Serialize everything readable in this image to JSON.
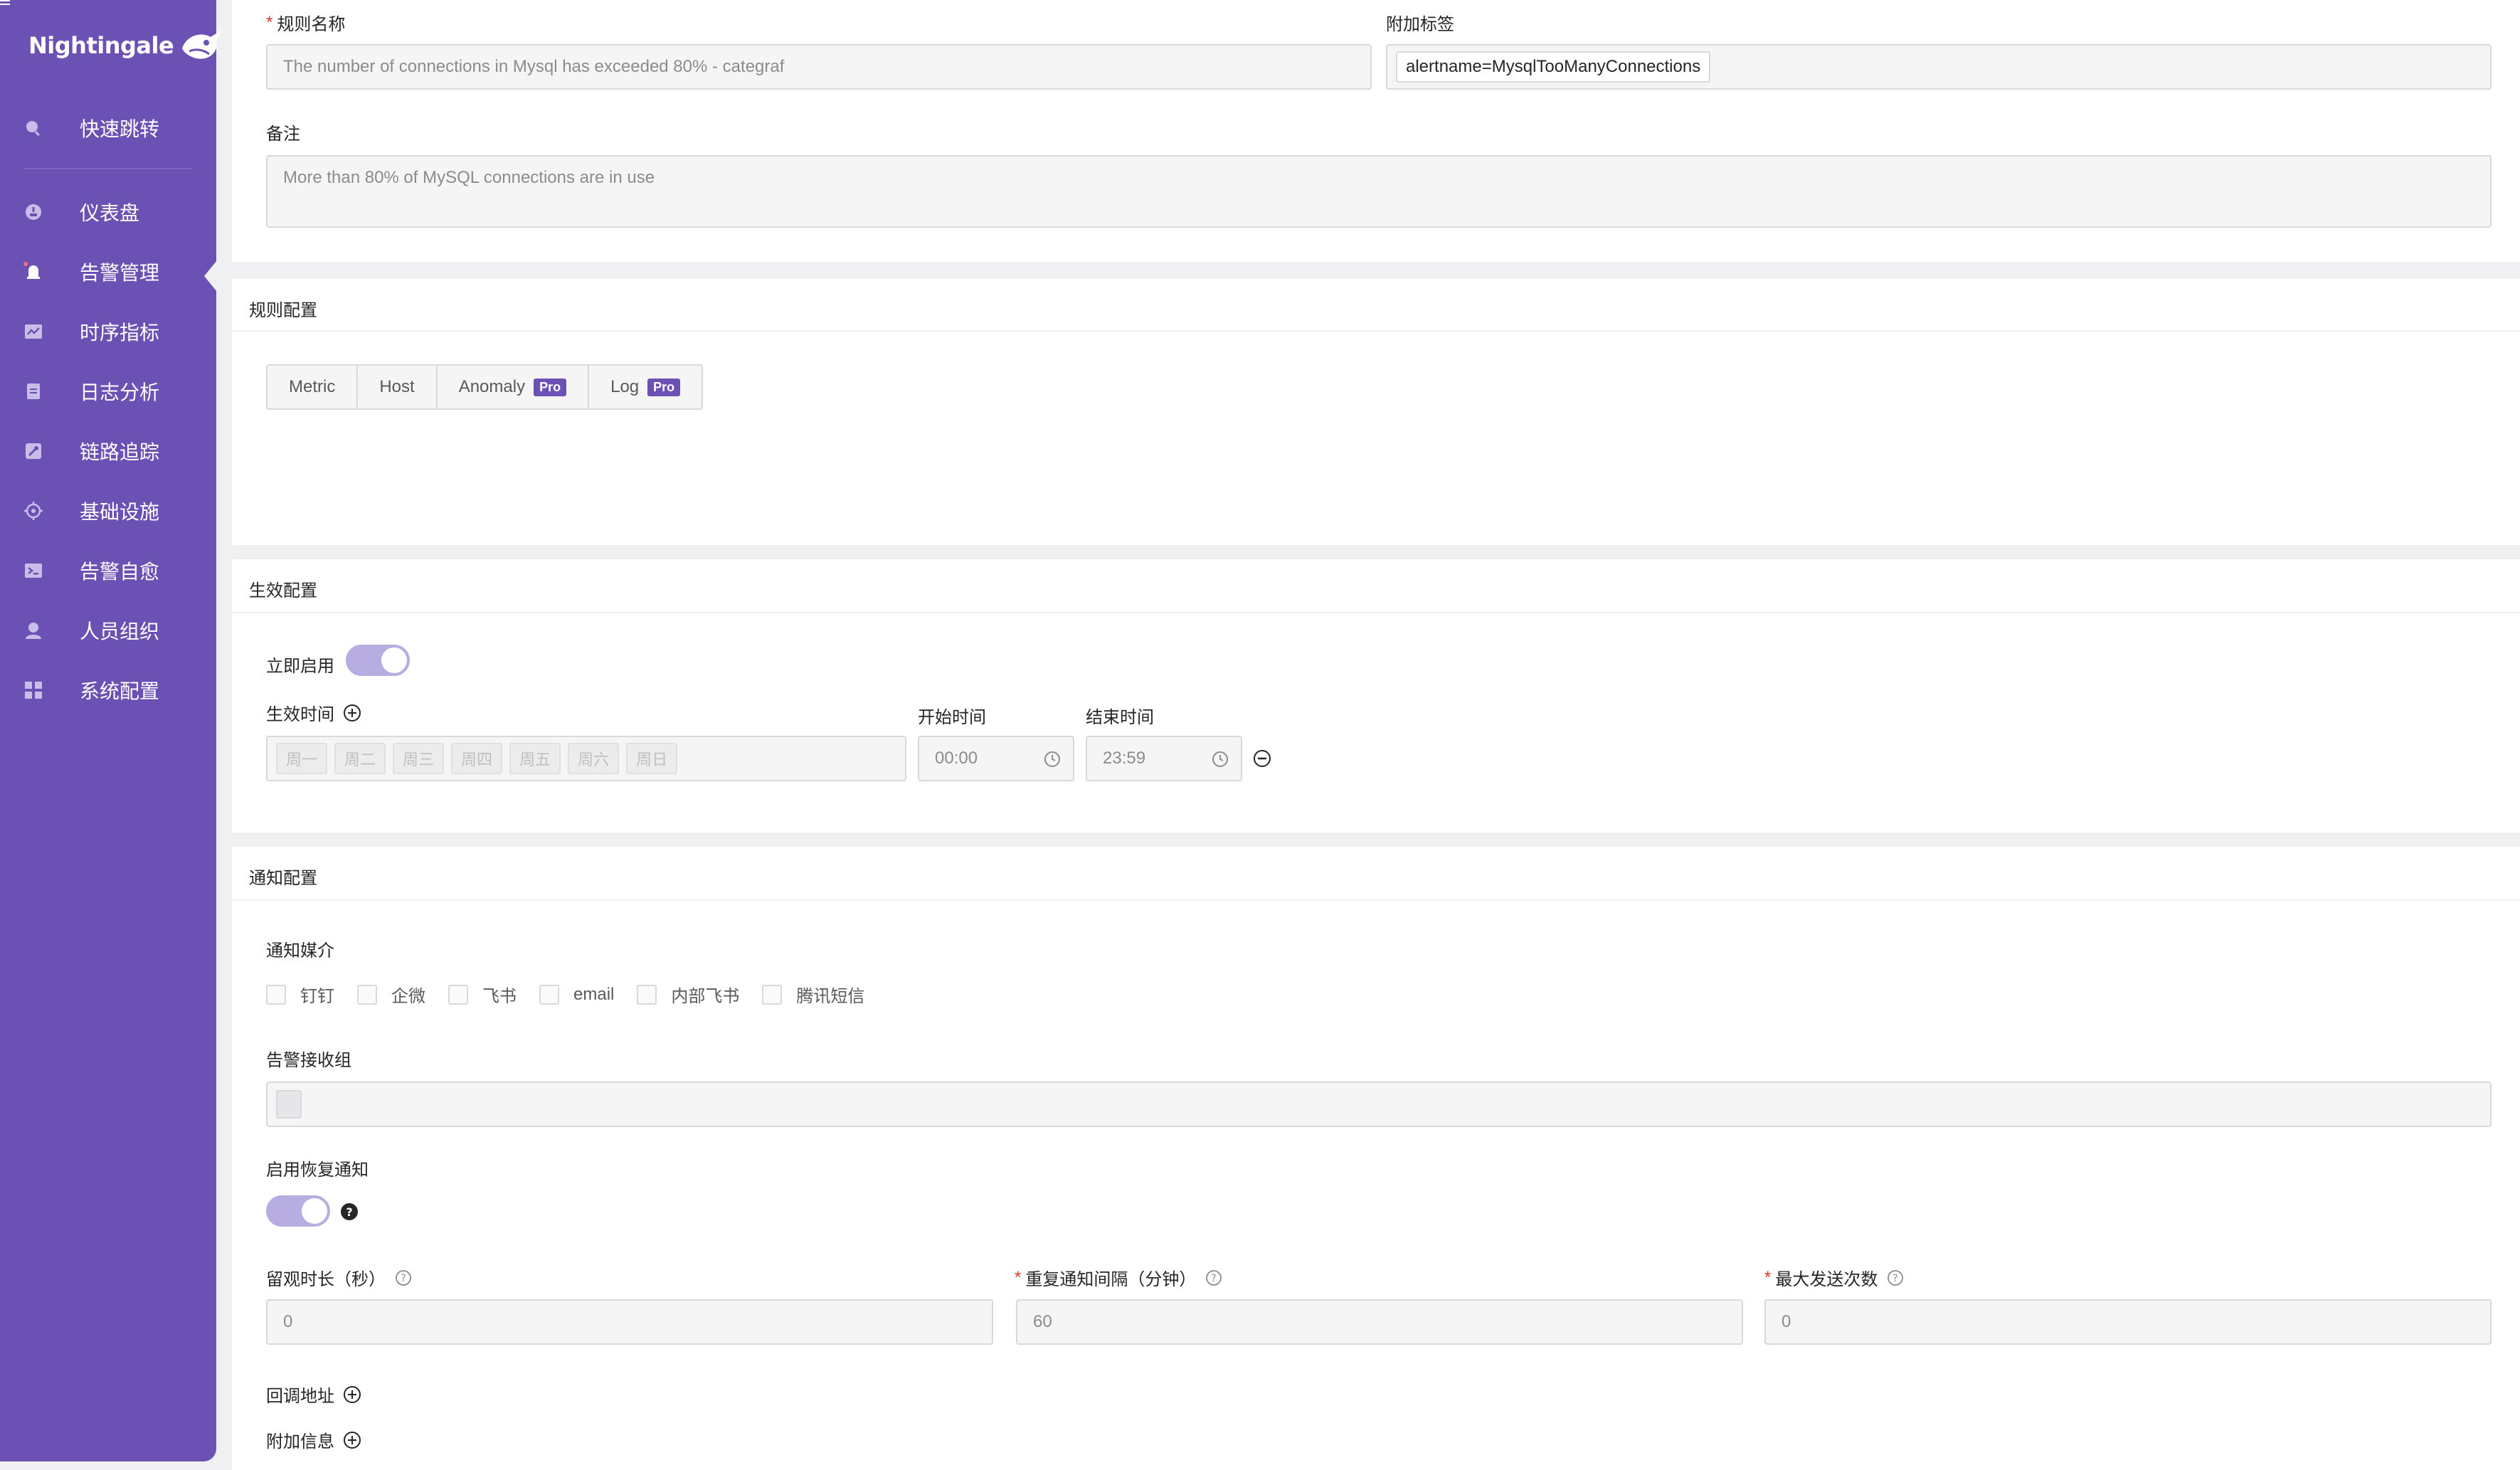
{
  "app": {
    "logo": "Nightingale"
  },
  "sidebar": {
    "items": [
      {
        "id": "quick-jump",
        "label": "快速跳转",
        "icon": "search-icon"
      },
      {
        "id": "dashboard",
        "label": "仪表盘",
        "icon": "dashboard-icon"
      },
      {
        "id": "alert-management",
        "label": "告警管理",
        "icon": "bell-icon"
      },
      {
        "id": "metrics",
        "label": "时序指标",
        "icon": "line-chart-icon"
      },
      {
        "id": "logs",
        "label": "日志分析",
        "icon": "document-icon"
      },
      {
        "id": "tracing",
        "label": "链路追踪",
        "icon": "trace-icon"
      },
      {
        "id": "infrastructure",
        "label": "基础设施",
        "icon": "target-icon"
      },
      {
        "id": "self-healing",
        "label": "告警自愈",
        "icon": "terminal-icon"
      },
      {
        "id": "people",
        "label": "人员组织",
        "icon": "user-icon"
      },
      {
        "id": "system",
        "label": "系统配置",
        "icon": "grid-icon"
      }
    ]
  },
  "basic": {
    "rule_name_label": "规则名称",
    "rule_name_value": "The number of connections in Mysql has exceeded 80% - categraf",
    "tags_label": "附加标签",
    "tag_value": "alertname=MysqlTooManyConnections",
    "note_label": "备注",
    "note_value": "More than 80% of MySQL connections are in use"
  },
  "rule_config": {
    "title": "规则配置",
    "types": [
      {
        "label": "Metric",
        "pro": ""
      },
      {
        "label": "Host",
        "pro": ""
      },
      {
        "label": "Anomaly",
        "pro": "Pro"
      },
      {
        "label": "Log",
        "pro": "Pro"
      }
    ]
  },
  "effective": {
    "title": "生效配置",
    "enable_label": "立即启用",
    "enable_on": true,
    "time_label": "生效时间",
    "start_label": "开始时间",
    "end_label": "结束时间",
    "weekdays": [
      "周一",
      "周二",
      "周三",
      "周四",
      "周五",
      "周六",
      "周日"
    ],
    "start_value": "00:00",
    "end_value": "23:59"
  },
  "notify": {
    "title": "通知配置",
    "media_label": "通知媒介",
    "media": [
      "钉钉",
      "企微",
      "飞书",
      "email",
      "内部飞书",
      "腾讯短信"
    ],
    "group_label": "告警接收组",
    "recovery_label": "启用恢复通知",
    "recovery_on": true,
    "observe_label": "留观时长（秒）",
    "observe_value": "0",
    "repeat_label": "重复通知间隔（分钟）",
    "repeat_value": "60",
    "max_label": "最大发送次数",
    "max_value": "0",
    "callback_label": "回调地址",
    "extra_label": "附加信息"
  },
  "colors": {
    "sidebar": "#6b51b4",
    "accent": "#6b51b4",
    "toggle": "#b7ade0",
    "required": "#e0382b"
  }
}
